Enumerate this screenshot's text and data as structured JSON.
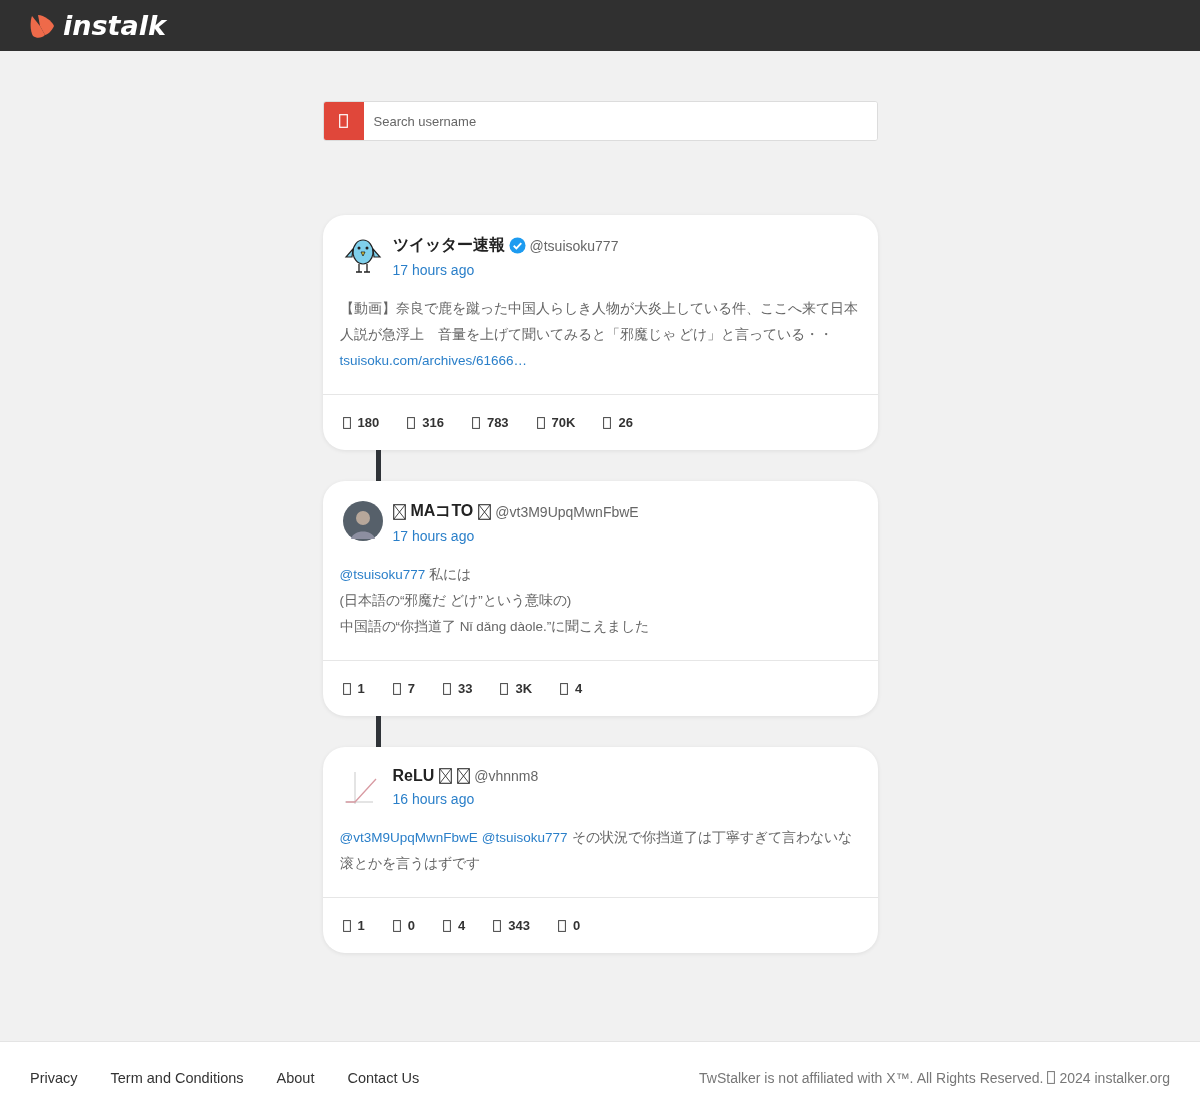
{
  "header": {
    "logo_text": "instalk"
  },
  "search": {
    "placeholder": "Search username"
  },
  "posts": [
    {
      "avatar": {
        "kind": "bird"
      },
      "name": [
        {
          "kind": "text",
          "text": "ツイッター速報"
        }
      ],
      "verified": true,
      "handle": "@tsuisoku777",
      "time": "17 hours ago",
      "lines": [
        [
          {
            "kind": "text",
            "text": "【動画】奈良で鹿を蹴った中国人らしき人物が大炎上している件、ここへ来て日本人説が急浮上　音量を上げて聞いてみると「邪魔じゃ どけ」と言っている・・"
          }
        ],
        [
          {
            "kind": "link",
            "text": "tsuisoku.com/archives/61666…"
          }
        ]
      ],
      "stats": [
        "180",
        "316",
        "783",
        "70K",
        "26"
      ]
    },
    {
      "avatar": {
        "kind": "person"
      },
      "name": [
        {
          "kind": "box"
        },
        {
          "kind": "text",
          "text": "MAコTO"
        },
        {
          "kind": "box"
        }
      ],
      "verified": false,
      "handle": "@vt3M9UpqMwnFbwE",
      "time": "17 hours ago",
      "lines": [
        [
          {
            "kind": "mention",
            "text": "@tsuisoku777"
          },
          {
            "kind": "text",
            "text": "私には"
          }
        ],
        [
          {
            "kind": "text",
            "text": "(日本語の“邪魔だ どけ”という意味の)"
          }
        ],
        [
          {
            "kind": "text",
            "text": "中国語の“你挡道了  Nǐ dǎng dàole.”に聞こえました"
          }
        ]
      ],
      "stats": [
        "1",
        "7",
        "33",
        "3K",
        "4"
      ]
    },
    {
      "avatar": {
        "kind": "chart"
      },
      "name": [
        {
          "kind": "text",
          "text": "ReLU"
        },
        {
          "kind": "box"
        },
        {
          "kind": "box"
        }
      ],
      "verified": false,
      "handle": "@vhnnm8",
      "time": "16 hours ago",
      "lines": [
        [
          {
            "kind": "mention",
            "text": "@vt3M9UpqMwnFbwE"
          },
          {
            "kind": "mention",
            "text": "@tsuisoku777"
          },
          {
            "kind": "text",
            "text": "その状況で你挡道了は丁寧すぎて言わないな"
          }
        ],
        [
          {
            "kind": "text",
            "text": "滚とかを言うはずです"
          }
        ]
      ],
      "stats": [
        "1",
        "0",
        "4",
        "343",
        "0"
      ]
    }
  ],
  "footer": {
    "links": [
      "Privacy",
      "Term and Conditions",
      "About",
      "Contact Us"
    ],
    "notice_before": "TwStalker is not affiliated with X™. All Rights Reserved.",
    "notice_after": "2024 instalker.org"
  }
}
